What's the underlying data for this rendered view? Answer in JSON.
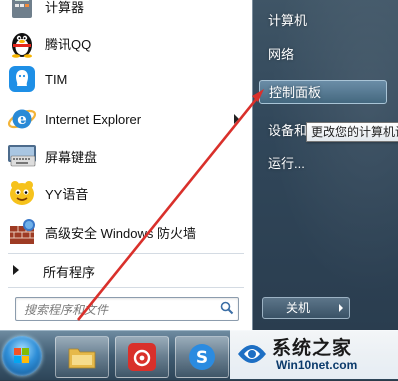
{
  "start_menu": {
    "programs": [
      {
        "label": "计算器",
        "icon": "calculator-icon"
      },
      {
        "label": "腾讯QQ",
        "icon": "qq-penguin-icon"
      },
      {
        "label": "TIM",
        "icon": "tim-icon"
      },
      {
        "label": "Internet Explorer",
        "icon": "internet-explorer-icon",
        "has_submenu": true
      },
      {
        "label": "屏幕键盘",
        "icon": "keyboard-icon"
      },
      {
        "label": "YY语音",
        "icon": "yy-voice-icon"
      },
      {
        "label": "高级安全 Windows 防火墙",
        "icon": "firewall-icon"
      }
    ],
    "all_programs": "所有程序",
    "search_placeholder": "搜索程序和文件",
    "right_links": [
      "计算机",
      "网络",
      "控制面板",
      "设备和打印机",
      "运行..."
    ],
    "tooltip": "更改您的计算机设",
    "shutdown_label": "关机"
  },
  "watermark": {
    "title": "系统之家",
    "subtitle": "Win10net.com"
  },
  "colors": {
    "accent": "#44687f",
    "arrow": "#d9302b"
  }
}
